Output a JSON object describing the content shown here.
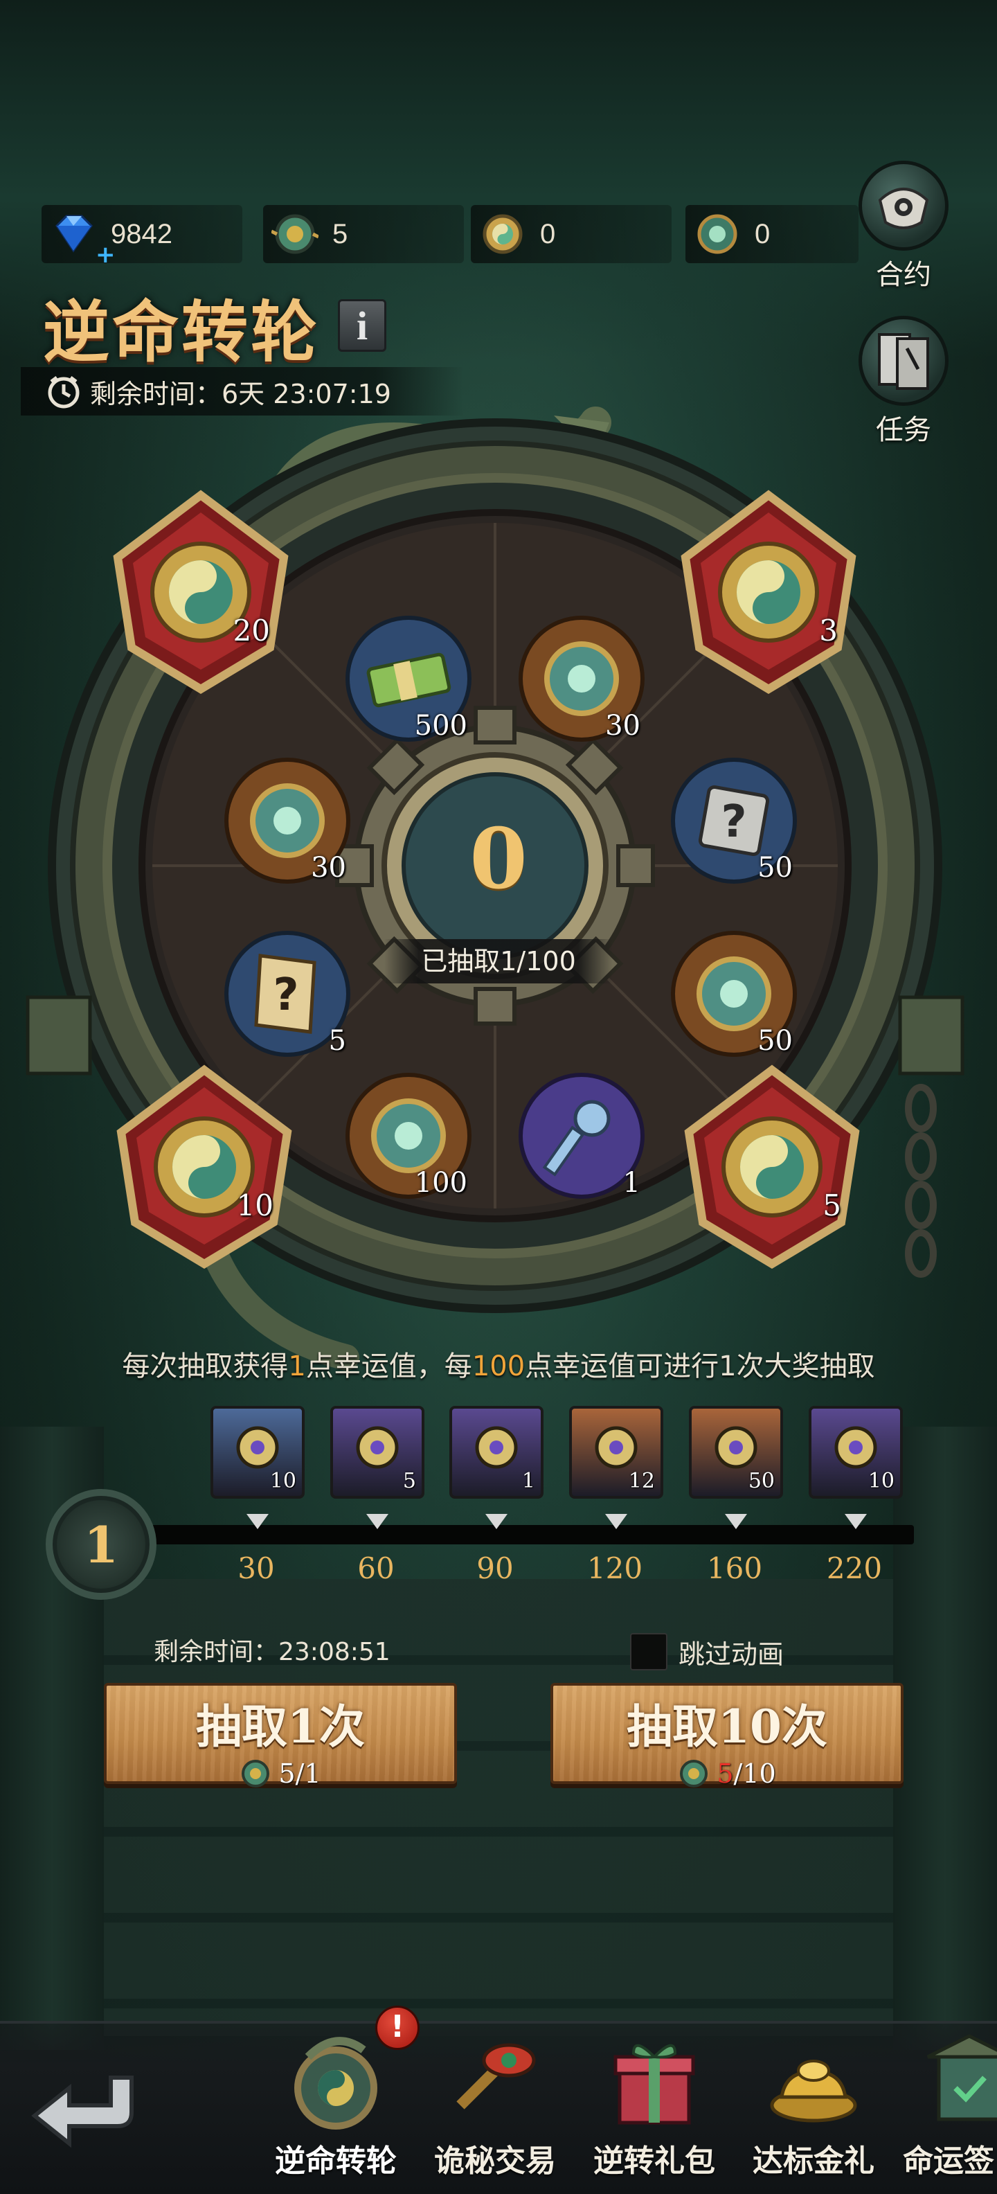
{
  "currencies": [
    {
      "name": "diamond-icon",
      "value": "9842"
    },
    {
      "name": "coin-icon",
      "value": "5"
    },
    {
      "name": "coin-yinyang-icon",
      "value": "0"
    },
    {
      "name": "coin-jade-icon",
      "value": "0"
    }
  ],
  "side_buttons": {
    "contract": "合约",
    "tasks": "任务"
  },
  "title": "逆命转轮",
  "info_label": "i",
  "timer": "剩余时间：6天 23:07:19",
  "wheel": {
    "center_count": "0",
    "drawn_text": "已抽取1/100",
    "big_slots": [
      {
        "qty": "20",
        "icon": "yinyang-token-icon"
      },
      {
        "qty": "3",
        "icon": "yinyang-token-icon"
      },
      {
        "qty": "10",
        "icon": "yinyang-token-icon"
      },
      {
        "qty": "5",
        "icon": "yinyang-token-icon"
      }
    ],
    "slots": [
      {
        "qty": "500",
        "icon": "cash-stack-icon"
      },
      {
        "qty": "30",
        "icon": "jade-coin-icon"
      },
      {
        "qty": "30",
        "icon": "jade-coin-icon"
      },
      {
        "qty": "50",
        "icon": "mystery-tile-icon"
      },
      {
        "qty": "5",
        "icon": "mystery-scroll-icon"
      },
      {
        "qty": "50",
        "icon": "jade-coin-icon"
      },
      {
        "qty": "100",
        "icon": "jade-coin-icon"
      },
      {
        "qty": "1",
        "icon": "silver-key-icon"
      }
    ]
  },
  "rule": {
    "p1": "每次抽取获得",
    "n1": "1",
    "p2": "点幸运值，每",
    "n2": "100",
    "p3": "点幸运值可进行1次大奖抽取"
  },
  "level": "1",
  "milestones": [
    {
      "qty": "10",
      "threshold": "30",
      "icon": "silver-key-icon",
      "color": "#4d6a99"
    },
    {
      "qty": "5",
      "threshold": "60",
      "icon": "gold-key-icon",
      "color": "#5a4990"
    },
    {
      "qty": "1",
      "threshold": "90",
      "icon": "mystery-gem-icon",
      "color": "#5a4990"
    },
    {
      "qty": "12",
      "threshold": "120",
      "icon": "purple-dust-icon",
      "color": "#a9653a"
    },
    {
      "qty": "50",
      "threshold": "160",
      "icon": "golden-bell-icon",
      "color": "#a9653a"
    },
    {
      "qty": "10",
      "threshold": "220",
      "icon": "gold-key-icon",
      "color": "#5a4990"
    }
  ],
  "draw": {
    "remaining_time": "剩余时间：23:08:51",
    "skip_animation": "跳过动画",
    "single": {
      "label": "抽取1次",
      "cost_have": "5",
      "cost_need": "/1"
    },
    "ten": {
      "label": "抽取10次",
      "cost_have": "5",
      "cost_need": "/10"
    }
  },
  "nav": {
    "alert": "!",
    "items": [
      {
        "label": "逆命转轮",
        "icon": "wheel-dragon-icon"
      },
      {
        "label": "诡秘交易",
        "icon": "eye-scepter-icon"
      },
      {
        "label": "逆转礼包",
        "icon": "gift-box-icon"
      },
      {
        "label": "达标金礼",
        "icon": "gold-ingot-icon"
      },
      {
        "label": "命运签",
        "icon": "fate-lantern-icon"
      }
    ]
  },
  "colors": {
    "gold": "#f0c470",
    "highlight": "#f0a43a",
    "cost_red": "#e8322a"
  }
}
